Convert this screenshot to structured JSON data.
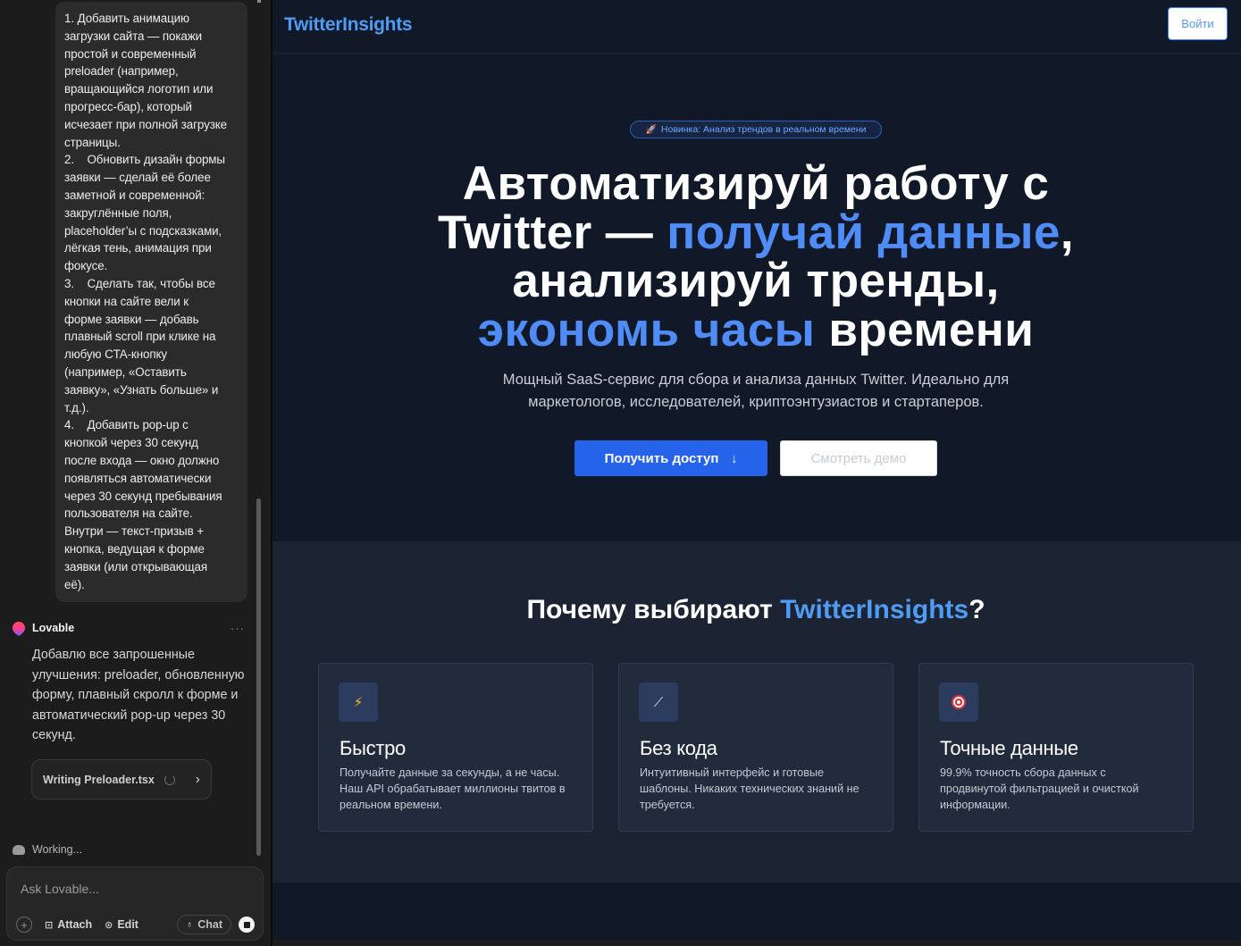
{
  "chat": {
    "user_message": "1. Добавить анимацию\nзагрузки сайта — покажи\nпростой и современный\npreloader (например,\nвращающийся логотип или\nпрогресс-бар), который\nисчезает при полной загрузке\nстраницы.\n2.    Обновить дизайн формы\nзаявки — сделай её более\nзаметной и современной:\nзакруглённые поля,\nplaceholder’ы с подсказками,\nлёгкая тень, анимация при\nфокусе.\n3.    Сделать так, чтобы все\nкнопки на сайте вели к\nформе заявки — добавь\nплавный scroll при клике на\nлюбую CTA-кнопку\n(например, «Оставить\nзаявку», «Узнать больше» и\nт.д.).\n4.    Добавить pop-up с\nкнопкой через 30 секунд\nпосле входа — окно должно\nпоявляться автоматически\nчерез 30 секунд пребывания\nпользователя на сайте.\nВнутри — текст-призыв +\nкнопка, ведущая к форме\nзаявки (или открывающая\nеё).",
    "assistant_name": "Lovable",
    "assistant_more": "···",
    "assistant_message": "Добавлю все запрошенные улучшения: preloader, обновленную форму, плавный скролл к форме и автоматический pop-up через 30 секунд.",
    "file_chip_label": "Writing Preloader.tsx",
    "file_chip_chevron": "›",
    "working_label": "Working...",
    "composer": {
      "placeholder": "Ask Lovable...",
      "plus": "+",
      "attach_label": "Attach",
      "edit_label": "Edit",
      "chat_label": "Chat"
    },
    "icons": [
      "lovable-logo",
      "spinner-icon",
      "chevron-right-icon",
      "cloud-icon",
      "plus-icon",
      "attach-icon",
      "edit-icon",
      "bulb-icon",
      "stop-icon"
    ]
  },
  "preview": {
    "brand": "TwitterInsights",
    "login_label": "Войти",
    "badge": {
      "icon": "rocket-icon",
      "icon_glyph": "🚀",
      "text": "Новинка: Анализ трендов в реальном времени"
    },
    "hero_title": {
      "line1": "Автоматизируй работу с",
      "line2_plain": "Twitter — ",
      "line2_accent": "получай данные",
      "line2_end": ",",
      "line3": "анализируй тренды,",
      "line4_accent": "экономь часы",
      "line4_plain": " времени"
    },
    "hero_subtitle": "Мощный SaaS-сервис для сбора и анализа данных Twitter. Идеально для маркетологов, исследователей, криптоэнтузиастов и стартаперов.",
    "cta_primary": "Получить доступ",
    "cta_primary_arrow": "↓",
    "cta_secondary": "Смотреть демо",
    "features_title_plain": "Почему выбирают ",
    "features_title_accent": "TwitterInsights",
    "features_title_end": "?",
    "features": [
      {
        "icon": "lightning-icon",
        "icon_glyph": "⚡",
        "title": "Быстро",
        "description": "Получайте данные за секунды, а не часы. Наш API обрабатывает миллионы твитов в реальном времени."
      },
      {
        "icon": "magic-wand-icon",
        "icon_glyph": "⟋",
        "title": "Без кода",
        "description": "Интуитивный интерфейс и готовые шаблоны. Никаких технических знаний не требуется."
      },
      {
        "icon": "target-icon",
        "icon_glyph": "",
        "title": "Точные данные",
        "description": "99.9% точность сбора данных с продвинутой фильтрацией и очисткой информации."
      }
    ]
  },
  "colors": {
    "accent": "#4f8cf7",
    "primary_button": "#2563eb",
    "preview_bg": "#111827",
    "features_bg": "#1c2333",
    "chat_bg": "#1c1c1c"
  }
}
